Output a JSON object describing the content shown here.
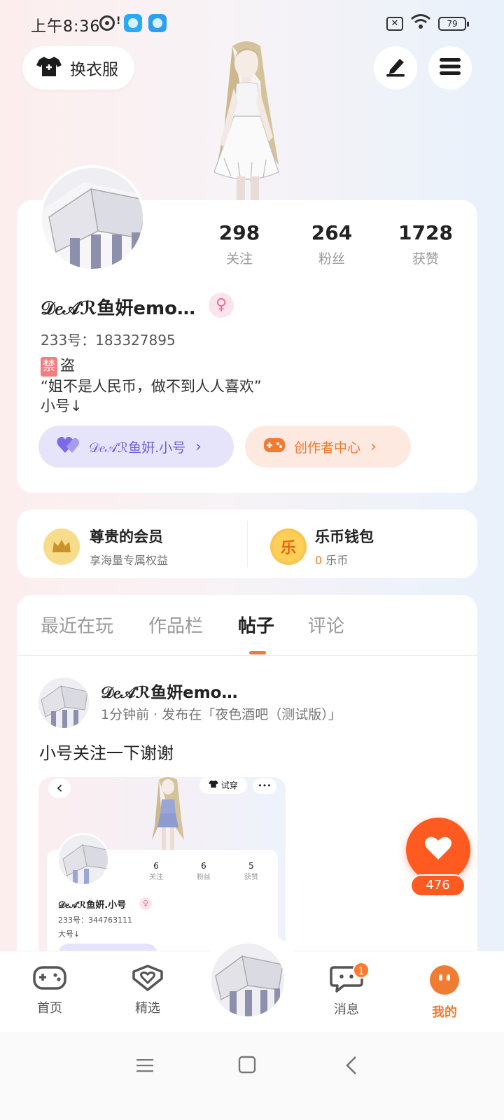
{
  "status_bar": {
    "time": "上午8:36",
    "notification_mark": "!",
    "battery": "79",
    "battery_x": "✕"
  },
  "header": {
    "dress_up_label": "换衣服"
  },
  "profile": {
    "stats": [
      {
        "value": "298",
        "label": "关注"
      },
      {
        "value": "264",
        "label": "粉丝"
      },
      {
        "value": "1728",
        "label": "获赞"
      }
    ],
    "nickname": "𝒟𝑒𝒜ℛ鱼姸emo…",
    "gender_symbol": "♀",
    "uid": "233号：183327895",
    "bio_ban_tag": "禁",
    "bio_line1": "盗",
    "bio_line2": "“姐不是人民币，做不到人人喜欢”",
    "bio_line3": "小号↓",
    "alt_account_label": "𝒟𝑒𝒜ℛ鱼姸.小号",
    "creator_center_label": "创作者中心",
    "chevron": "›"
  },
  "member": {
    "vip_title": "尊贵的会员",
    "vip_subtitle": "享海量专属权益",
    "wallet_title": "乐币钱包",
    "wallet_coin_glyph": "乐",
    "wallet_balance": "0",
    "wallet_unit": "乐币"
  },
  "tabs": [
    {
      "label": "最近在玩",
      "active": false
    },
    {
      "label": "作品栏",
      "active": false
    },
    {
      "label": "帖子",
      "active": true
    },
    {
      "label": "评论",
      "active": false
    }
  ],
  "post": {
    "author": "𝒟𝑒𝒜ℛ鱼姸emo…",
    "meta": "1分钟前 · 发布在「夜色酒吧（测试版）」",
    "text": "小号关注一下谢谢",
    "thumbnail": {
      "back": "‹",
      "try_on_label": "试穿",
      "more": "•••",
      "stats": [
        {
          "value": "6",
          "label": "关注"
        },
        {
          "value": "6",
          "label": "粉丝"
        },
        {
          "value": "5",
          "label": "获赞"
        }
      ],
      "nickname": "𝒟𝑒𝒜ℛ鱼姸.小号",
      "uid": "233号：344763111",
      "bio": "大号↓"
    }
  },
  "like": {
    "count": "476"
  },
  "bottom_nav": {
    "items": [
      {
        "label": "首页",
        "icon": "gamepad-icon"
      },
      {
        "label": "精选",
        "icon": "heart-box-icon"
      },
      {
        "label": "消息",
        "icon": "chat-icon",
        "badge": "1"
      },
      {
        "label": "我的",
        "icon": "face-icon",
        "active": true
      }
    ]
  },
  "colors": {
    "accent": "#f07b33",
    "like": "#ff5a1f",
    "alt_pill_bg": "#e6e4fb",
    "alt_pill_text": "#6a5fd8",
    "creator_pill_bg": "#fde9e0"
  }
}
